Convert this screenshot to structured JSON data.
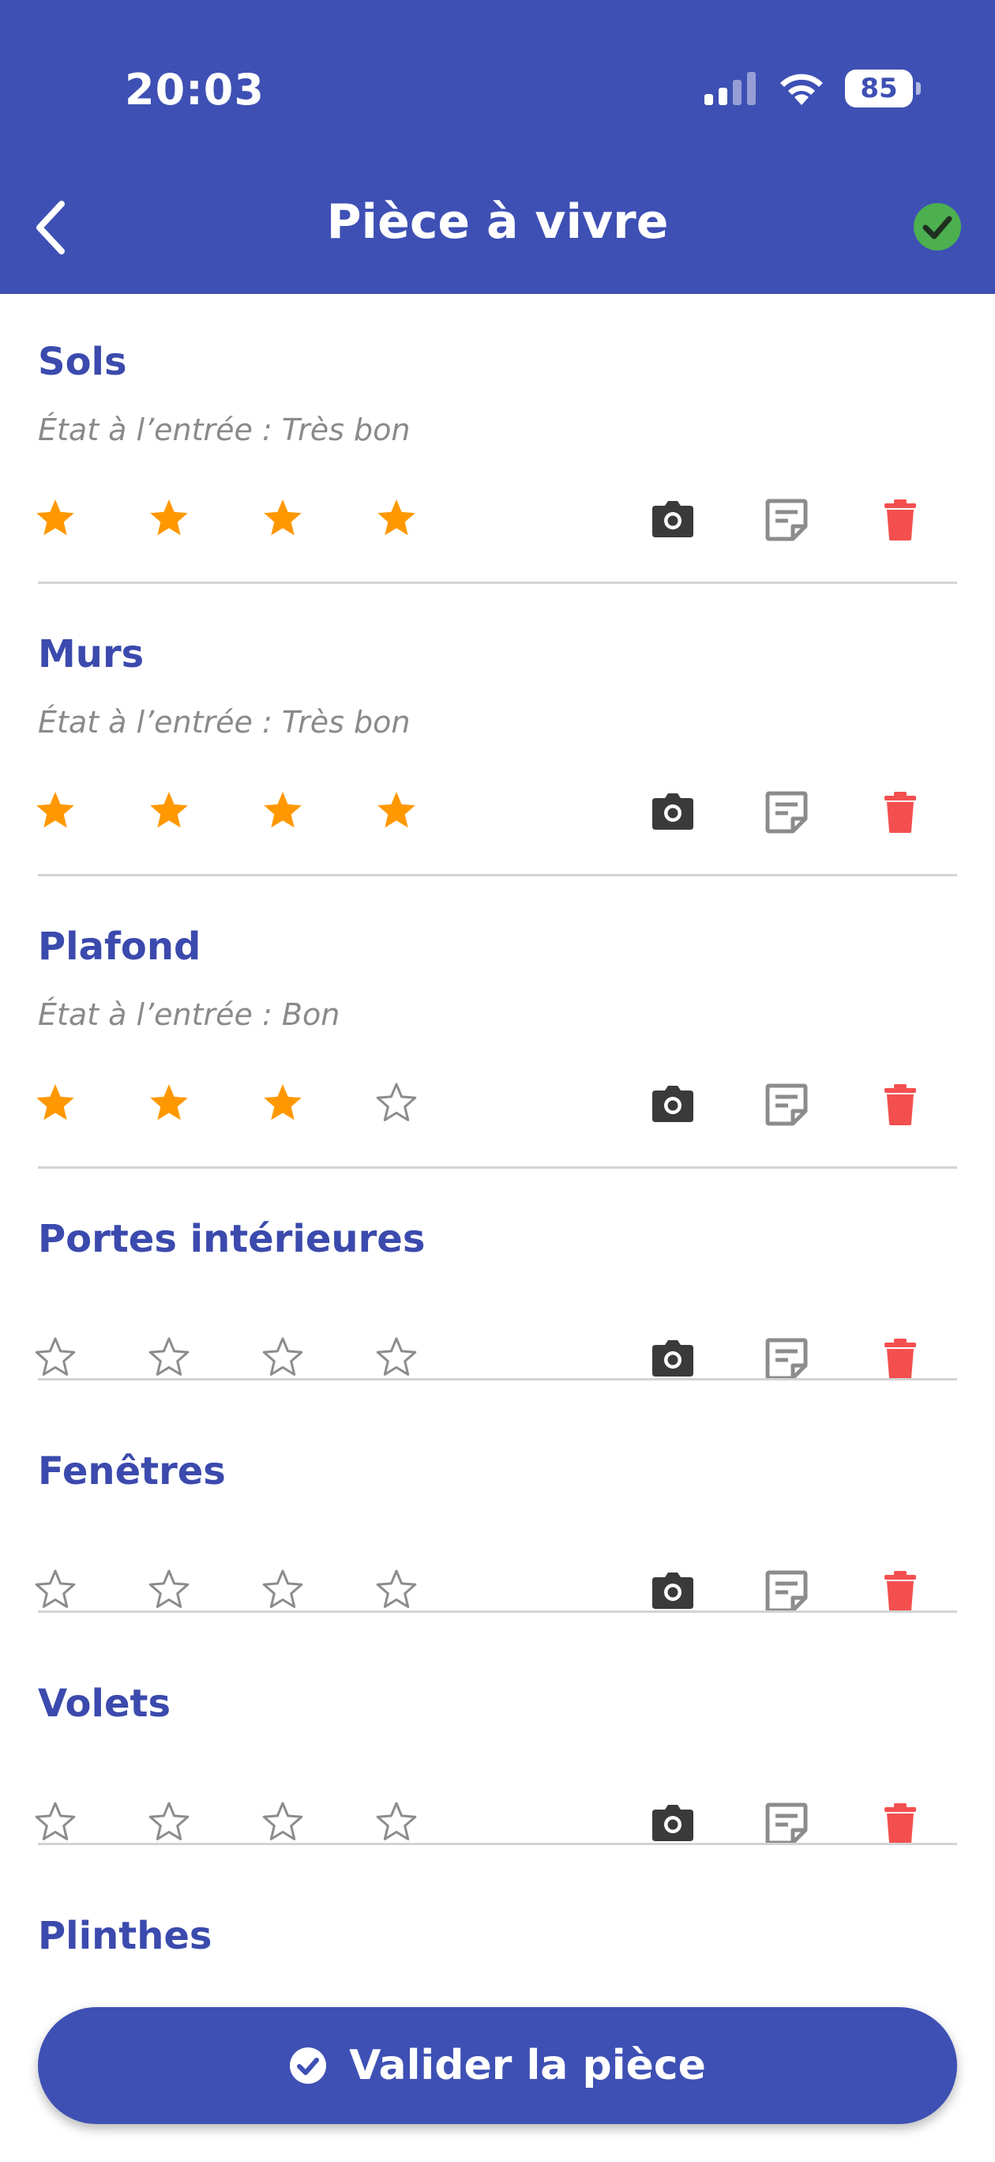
{
  "status_bar": {
    "time": "20:03",
    "battery": "85"
  },
  "header": {
    "title": "Pièce à vivre"
  },
  "colors": {
    "primary": "#3e50b4",
    "star_filled": "#ff9800",
    "star_empty": "#8c8c8c",
    "camera": "#3a3a3a",
    "note": "#8c8c8c",
    "delete": "#f44f4f",
    "check": "#4caf50"
  },
  "items": [
    {
      "name": "Sols",
      "state": "État à l’entrée : Très bon",
      "rating": 4,
      "max_rating": 4
    },
    {
      "name": "Murs",
      "state": "État à l’entrée : Très bon",
      "rating": 4,
      "max_rating": 4
    },
    {
      "name": "Plafond",
      "state": "État à l’entrée : Bon",
      "rating": 3,
      "max_rating": 4
    },
    {
      "name": "Portes intérieures",
      "state": "",
      "rating": 0,
      "max_rating": 4
    },
    {
      "name": "Fenêtres",
      "state": "",
      "rating": 0,
      "max_rating": 4
    },
    {
      "name": "Volets",
      "state": "",
      "rating": 0,
      "max_rating": 4
    },
    {
      "name": "Plinthes",
      "state": "",
      "rating": 0,
      "max_rating": 4
    }
  ],
  "footer": {
    "validate_label": "Valider la pièce"
  }
}
